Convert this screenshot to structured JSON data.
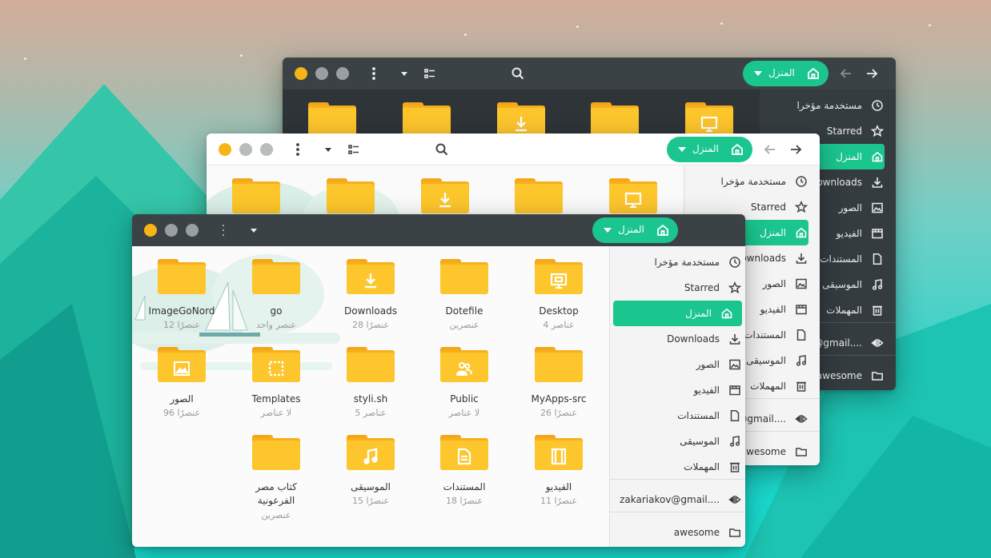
{
  "windows": {
    "back": {
      "pill_label": "المنزل",
      "sidebar": [
        {
          "label": "مستخدمة مؤخرا",
          "icon": "clock-icon"
        },
        {
          "label": "Starred",
          "icon": "star-icon"
        },
        {
          "label": "المنزل",
          "icon": "home-icon",
          "active": true
        },
        {
          "label": "Downloads",
          "icon": "download-icon"
        },
        {
          "label": "الصور",
          "icon": "image-icon"
        },
        {
          "label": "الفيديو",
          "icon": "film-icon"
        },
        {
          "label": "المستندات",
          "icon": "document-icon"
        },
        {
          "label": "الموسيقى",
          "icon": "music-icon"
        },
        {
          "label": "المهملات",
          "icon": "trash-icon"
        },
        {
          "label": "@gmail....",
          "icon": "network-icon"
        },
        {
          "label": "awesome",
          "icon": "folder-icon"
        }
      ]
    },
    "middle": {
      "pill_label": "المنزل",
      "sidebar": [
        {
          "label": "مستخدمة مؤخرا",
          "icon": "clock-icon"
        },
        {
          "label": "Starred",
          "icon": "star-icon"
        },
        {
          "label": "المنزل",
          "icon": "home-icon",
          "active": true
        },
        {
          "label": "Downloads",
          "icon": "download-icon"
        },
        {
          "label": "الصور",
          "icon": "image-icon"
        },
        {
          "label": "الفيديو",
          "icon": "film-icon"
        },
        {
          "label": "المستندات",
          "icon": "document-icon"
        },
        {
          "label": "الموسيقى",
          "icon": "music-icon"
        },
        {
          "label": "المهملات",
          "icon": "trash-icon"
        },
        {
          "label": "@gmail....",
          "icon": "network-icon"
        },
        {
          "label": "awesome",
          "icon": "folder-icon"
        }
      ]
    },
    "front": {
      "pill_label": "المنزل",
      "sidebar": [
        {
          "label": "مستخدمة مؤخرا",
          "icon": "clock-icon"
        },
        {
          "label": "Starred",
          "icon": "star-icon"
        },
        {
          "label": "المنزل",
          "icon": "home-icon",
          "active": true
        },
        {
          "label": "Downloads",
          "icon": "download-icon"
        },
        {
          "label": "الصور",
          "icon": "image-icon"
        },
        {
          "label": "الفيديو",
          "icon": "film-icon"
        },
        {
          "label": "المستندات",
          "icon": "document-icon"
        },
        {
          "label": "الموسيقى",
          "icon": "music-icon"
        },
        {
          "label": "المهملات",
          "icon": "trash-icon"
        },
        {
          "label": "zakariakov@gmail....",
          "icon": "network-icon"
        },
        {
          "label": "awesome",
          "icon": "folder-icon"
        }
      ],
      "files": [
        {
          "name": "Desktop",
          "count": "4 عناصر",
          "emblem": "desktop"
        },
        {
          "name": "Dotefile",
          "count": "عنصرين",
          "emblem": ""
        },
        {
          "name": "Downloads",
          "count": "28 عنصرًا",
          "emblem": "download"
        },
        {
          "name": "go",
          "count": "عنصر واحد",
          "emblem": ""
        },
        {
          "name": "ImageGoNord",
          "count": "12 عنصرًا",
          "emblem": ""
        },
        {
          "name": "MyApps-src",
          "count": "26 عنصرًا",
          "emblem": ""
        },
        {
          "name": "Public",
          "count": "لا عناصر",
          "emblem": "people"
        },
        {
          "name": "styli.sh",
          "count": "5 عناصر",
          "emblem": ""
        },
        {
          "name": "Templates",
          "count": "لا عناصر",
          "emblem": "template"
        },
        {
          "name": "الصور",
          "count": "96 عنصرًا",
          "emblem": "image"
        },
        {
          "name": "الفيديو",
          "count": "11 عنصرًا",
          "emblem": "film"
        },
        {
          "name": "المستندات",
          "count": "18 عنصرًا",
          "emblem": "document"
        },
        {
          "name": "الموسيقى",
          "count": "15 عنصرًا",
          "emblem": "music"
        },
        {
          "name": "كتاب مصر الفرعونية",
          "count": "عنصرين",
          "emblem": ""
        }
      ]
    }
  },
  "colors": {
    "accent": "#1bc58e",
    "folder": "#fdc62c",
    "close_dot": "#f7b416"
  }
}
